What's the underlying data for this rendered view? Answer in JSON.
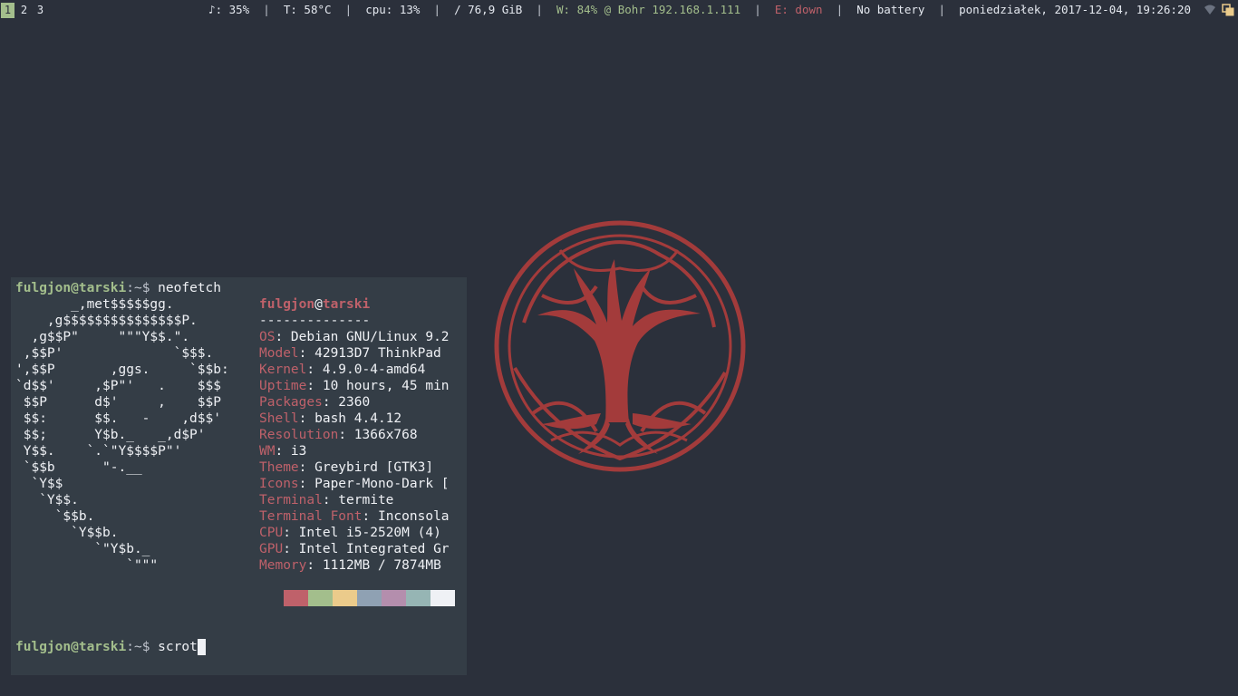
{
  "workspaces": [
    "1",
    "2",
    "3"
  ],
  "status_bar": {
    "volume": "♪: 35%",
    "temperature": "T: 58°C",
    "cpu": "cpu: 13%",
    "disk": "/ 76,9 GiB",
    "wireless": "W: 84% @ Bohr 192.168.1.111",
    "ethernet": "E: down",
    "battery": "No battery",
    "datetime": "poniedziałek, 2017-12-04, 19:26:20",
    "separator": "|"
  },
  "terminal": {
    "prompt_user": "fulgjon",
    "prompt_at": "@",
    "prompt_host": "tarski",
    "prompt_path": ":~$ ",
    "command1": "neofetch",
    "command2": "scrot",
    "ascii_lines": [
      "       _,met$$$$$gg.",
      "    ,g$$$$$$$$$$$$$$$P.",
      "  ,g$$P\"     \"\"\"Y$$.\".",
      " ,$$P'              `$$$.",
      "',$$P       ,ggs.     `$$b:",
      "`d$$'     ,$P\"'   .    $$$",
      " $$P      d$'     ,    $$P",
      " $$:      $$.   -    ,d$$'",
      " $$;      Y$b._   _,d$P'",
      " Y$$.    `.`\"Y$$$$P\"'",
      " `$$b      \"-.__",
      "  `Y$$",
      "   `Y$$.",
      "     `$$b.",
      "       `Y$$b.",
      "          `\"Y$b._",
      "              `\"\"\""
    ],
    "info_title_user": "fulgjon",
    "info_title_at": "@",
    "info_title_host": "tarski",
    "info_divider": "--------------",
    "info": [
      {
        "key": "OS",
        "value": ": Debian GNU/Linux 9.2"
      },
      {
        "key": "Model",
        "value": ": 42913D7 ThinkPad"
      },
      {
        "key": "Kernel",
        "value": ": 4.9.0-4-amd64"
      },
      {
        "key": "Uptime",
        "value": ": 10 hours, 45 min"
      },
      {
        "key": "Packages",
        "value": ": 2360"
      },
      {
        "key": "Shell",
        "value": ": bash 4.4.12"
      },
      {
        "key": "Resolution",
        "value": ": 1366x768"
      },
      {
        "key": "WM",
        "value": ": i3"
      },
      {
        "key": "Theme",
        "value": ": Greybird [GTK3]"
      },
      {
        "key": "Icons",
        "value": ": Paper-Mono-Dark ["
      },
      {
        "key": "Terminal",
        "value": ": termite"
      },
      {
        "key": "Terminal Font",
        "value": ": Inconsola"
      },
      {
        "key": "CPU",
        "value": ": Intel i5-2520M (4)"
      },
      {
        "key": "GPU",
        "value": ": Intel Integrated Gr"
      },
      {
        "key": "Memory",
        "value": ": 1112MB / 7874MB"
      }
    ],
    "palette": [
      "#343d46",
      "#bf616a",
      "#a3be8c",
      "#ebcb8b",
      "#8fa1b3",
      "#b48ead",
      "#96b5b4",
      "#eff1f5"
    ]
  },
  "colors": {
    "background": "#2b303b",
    "terminal_bg": "#343d46",
    "accent_red": "#bf616a",
    "accent_green": "#a3be8c",
    "tree": "#a33b3b"
  },
  "icons": [
    "wireless-icon",
    "window-stack-icon"
  ]
}
